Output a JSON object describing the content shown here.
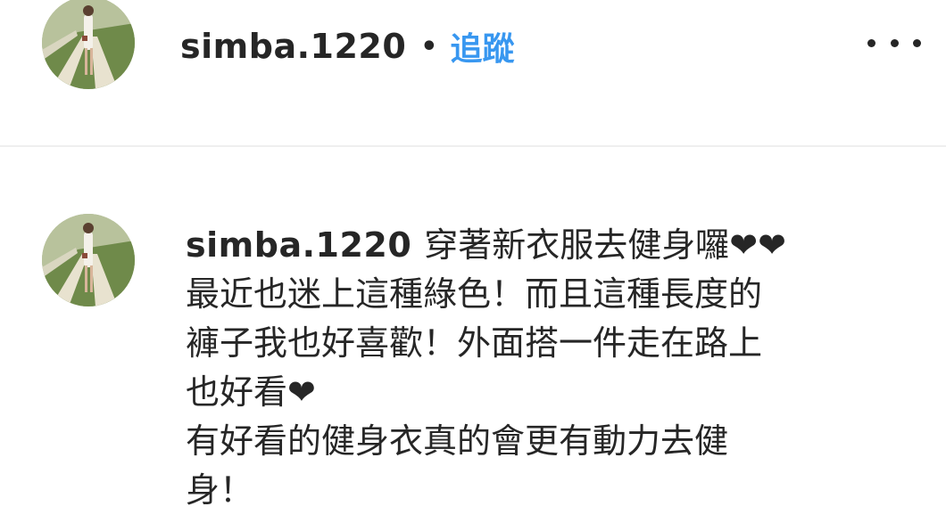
{
  "post": {
    "username": "simba.1220",
    "separator": "•",
    "follow_label": "追蹤",
    "more_icon": "more-options-icon"
  },
  "comment": {
    "username": "simba.1220",
    "lines": [
      "穿著新衣服去健身囉❤❤",
      "最近也迷上這種綠色！而且這種長度的",
      "褲子我也好喜歡！外面搭一件走在路上",
      "也好看❤",
      "有好看的健身衣真的會更有動力去健",
      "身！"
    ]
  },
  "colors": {
    "text": "#262626",
    "link": "#3897f0",
    "divider": "#efefef"
  }
}
